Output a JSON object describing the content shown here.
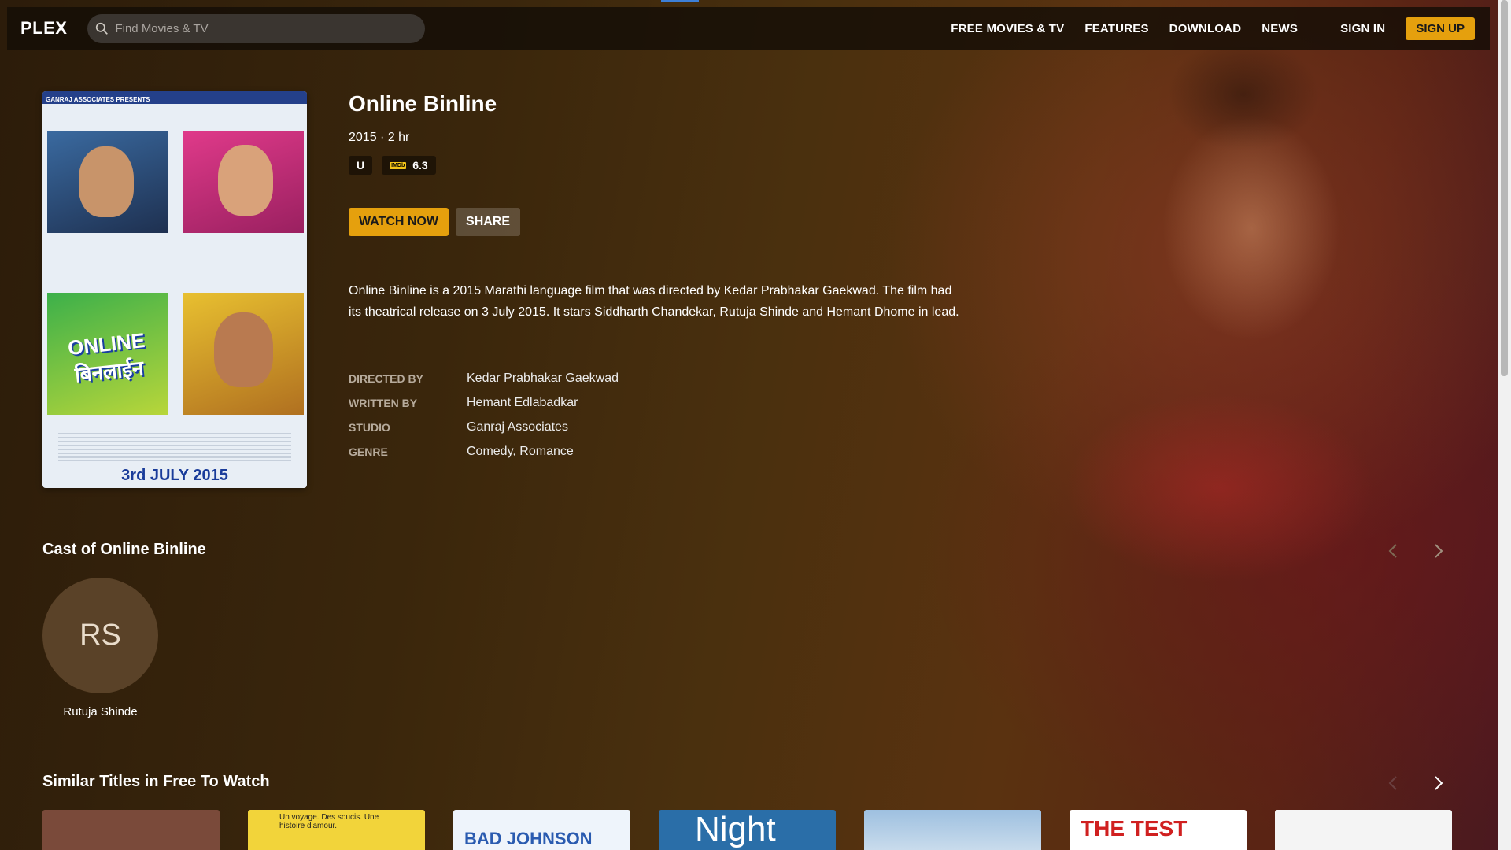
{
  "nav": {
    "logo_text": "PLEX",
    "search_placeholder": "Find Movies & TV",
    "links": [
      "FREE MOVIES & TV",
      "FEATURES",
      "DOWNLOAD",
      "NEWS"
    ],
    "sign_in": "SIGN IN",
    "sign_up": "SIGN UP"
  },
  "poster": {
    "top_strip": "GANRAJ ASSOCIATES PRESENTS",
    "logo_line1": "ONLINE",
    "logo_line2": "बिनलाईन",
    "release": "3rd JULY 2015"
  },
  "movie": {
    "title": "Online Binline",
    "meta": "2015 · 2 hr",
    "rating": "U",
    "imdb_label": "IMDb",
    "imdb_score": "6.3",
    "watch_label": "WATCH NOW",
    "share_label": "SHARE",
    "description": "Online Binline is a 2015 Marathi language film that was directed by Kedar Prabhakar Gaekwad. The film had its theatrical release on 3 July 2015. It stars Siddharth Chandekar, Rutuja Shinde and Hemant Dhome in lead.",
    "credits": [
      {
        "label": "DIRECTED BY",
        "value": "Kedar Prabhakar Gaekwad"
      },
      {
        "label": "WRITTEN BY",
        "value": "Hemant Edlabadkar"
      },
      {
        "label": "STUDIO",
        "value": "Ganraj Associates"
      },
      {
        "label": "GENRE",
        "value": "Comedy, Romance"
      }
    ]
  },
  "cast": {
    "title": "Cast of Online Binline",
    "members": [
      {
        "initials": "RS",
        "name": "Rutuja Shinde"
      }
    ]
  },
  "similar": {
    "title": "Similar Titles in Free To Watch",
    "thumbs": [
      {
        "color": "#7a4a3a",
        "text": ""
      },
      {
        "color": "#f2d43a",
        "text": "Un voyage. Des soucis. Une histoire d'amour."
      },
      {
        "color": "#eef4fb",
        "text": "BAD JOHNSON"
      },
      {
        "color": "#2a6ea8",
        "text": "Night"
      },
      {
        "color": "#b8d0e6",
        "text": ""
      },
      {
        "color": "#ffffff",
        "text": "THE TEST"
      },
      {
        "color": "#f4f4f4",
        "text": ""
      }
    ]
  },
  "colors": {
    "accent": "#e5a00d"
  }
}
